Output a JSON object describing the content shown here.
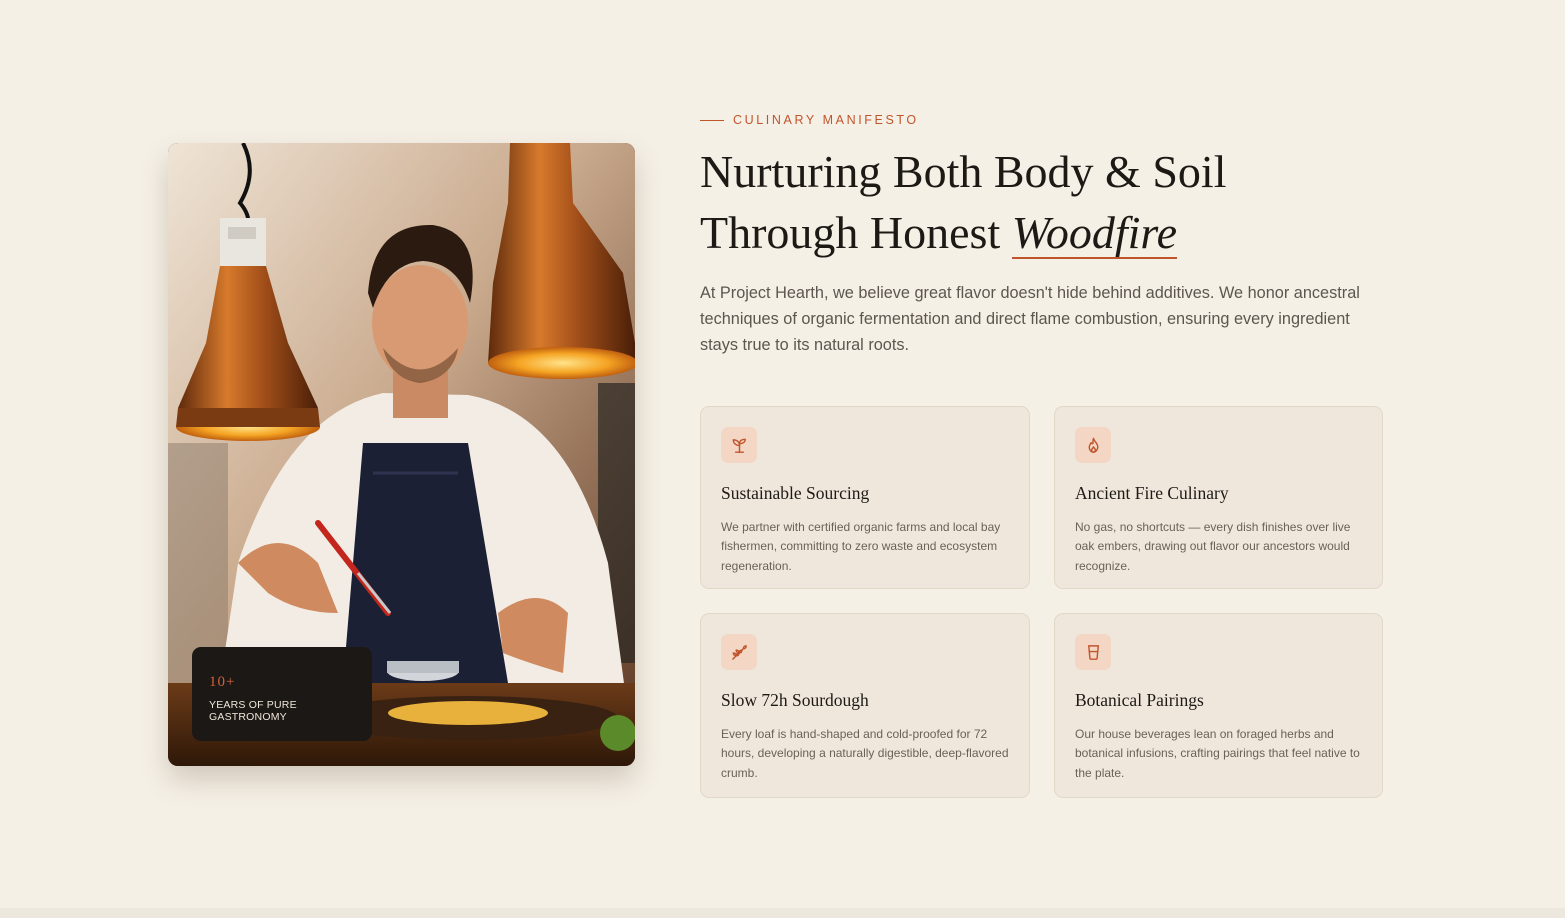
{
  "eyebrow": {
    "text": "Culinary Manifesto"
  },
  "headline": {
    "line1": "Nurturing Both Body & Soil",
    "line2_prefix": "Through Honest",
    "line2_accent": "Woodfire"
  },
  "intro": "At Project Hearth, we believe great flavor doesn't hide behind additives. We honor ancestral techniques of organic fermentation and direct flame combustion, ensuring every ingredient stays true to its natural roots.",
  "photo": {
    "subject": "chef-plating-under-heat-lamps",
    "badge": {
      "number": "10+",
      "label": "Years of Pure Gastronomy"
    }
  },
  "features": [
    {
      "icon": "sprout-icon",
      "title": "Sustainable Sourcing",
      "description": "We partner with certified organic farms and local bay fishermen, committing to zero waste and ecosystem regeneration."
    },
    {
      "icon": "flame-icon",
      "title": "Ancient Fire Culinary",
      "description": "No gas, no shortcuts — every dish finishes over live oak embers, drawing out flavor our ancestors would recognize."
    },
    {
      "icon": "wheat-icon",
      "title": "Slow 72h Sourdough",
      "description": "Every loaf is hand-shaped and cold-proofed for 72 hours, developing a naturally digestible, deep-flavored crumb."
    },
    {
      "icon": "cup-icon",
      "title": "Botanical Pairings",
      "description": "Our house beverages lean on foraged herbs and botanical infusions, crafting pairings that feel native to the plate."
    }
  ],
  "colors": {
    "background": "#f5f0e6",
    "accent": "#c0552c",
    "card": "#efe7dc",
    "icon_tile": "#f3d6c4",
    "badge": "#1b1815"
  }
}
